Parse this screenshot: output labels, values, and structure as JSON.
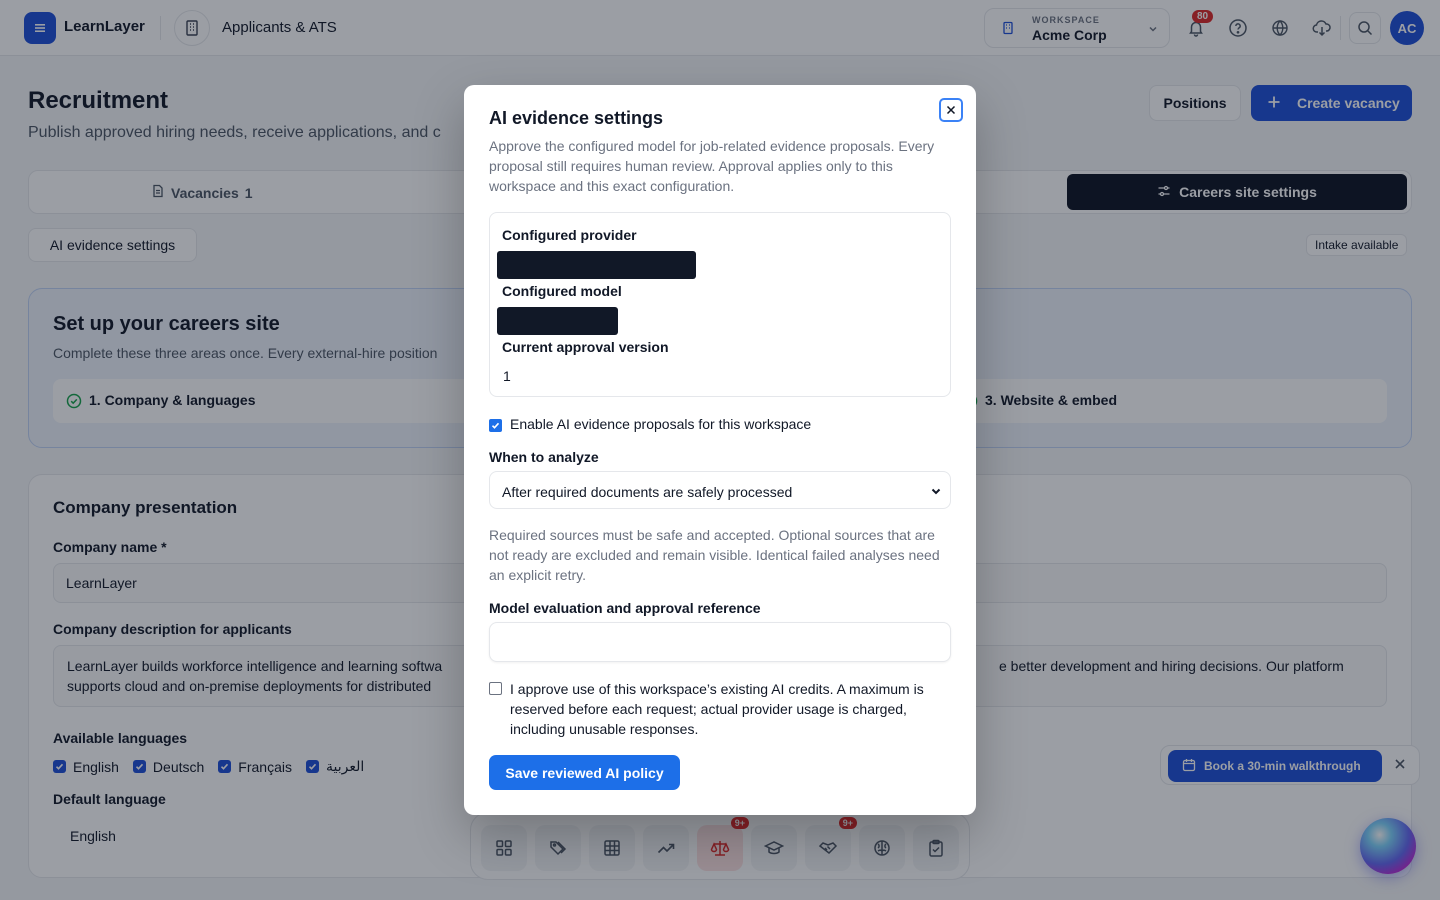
{
  "app": {
    "name": "LearnLayer",
    "module_title": "Applicants & ATS"
  },
  "workspace": {
    "label": "WORKSPACE",
    "name": "Acme Corp"
  },
  "header": {
    "notifications_count": "80",
    "avatar_initials": "AC"
  },
  "page": {
    "title": "Recruitment",
    "subtitle": "Publish approved hiring needs, receive applications, and c",
    "positions_label": "Positions",
    "create_label": "Create vacancy"
  },
  "tabs": {
    "vacancies_label": "Vacancies",
    "vacancies_count": "1",
    "careers_label": "Careers site settings"
  },
  "ai_settings_button": "AI evidence settings",
  "intake_badge": "Intake available",
  "setup": {
    "title": "Set up your careers site",
    "desc": "Complete these three areas once. Every external-hire position",
    "step1": "1. Company & languages",
    "step3": "3. Website & embed"
  },
  "presentation": {
    "title": "Company presentation",
    "company_name_label": "Company name *",
    "company_name_value": "LearnLayer",
    "desc_label": "Company description for applicants",
    "desc_line1_left": "LearnLayer builds workforce intelligence and learning softwa",
    "desc_line1_right": "e better development and hiring decisions. Our platform",
    "desc_line2_left": "supports cloud and on-premise deployments for distributed",
    "languages_label": "Available languages",
    "languages": [
      "English",
      "Deutsch",
      "Français",
      "العربية"
    ],
    "default_lang_label": "Default language",
    "default_lang_value": "English"
  },
  "dock": {
    "badge_a": "9+",
    "badge_b": "9+"
  },
  "walkthrough": {
    "label": "Book a 30-min walkthrough"
  },
  "modal": {
    "title": "AI evidence settings",
    "description": "Approve the configured model for job-related evidence proposals. Every proposal still requires human review. Approval applies only to this workspace and this exact configuration.",
    "provider_label": "Configured provider",
    "provider_value": "redacted-provider",
    "model_label": "Configured model",
    "model_value": "redacted-model",
    "version_label": "Current approval version",
    "version_value": "1",
    "enable_label": "Enable AI evidence proposals for this workspace",
    "enable_checked": true,
    "analyze_label": "When to analyze",
    "analyze_value": "After required documents are safely processed",
    "help_text": "Required sources must be safe and accepted. Optional sources that are not ready are excluded and remain visible. Identical failed analyses need an explicit retry.",
    "reference_label": "Model evaluation and approval reference",
    "reference_value": "",
    "approve_text": "I approve use of this workspace’s existing AI credits. A maximum is reserved before each request; actual provider usage is charged, including unusable responses.",
    "approve_checked": false,
    "save_label": "Save reviewed AI policy"
  },
  "colors": {
    "accent": "#1d6fe8",
    "brand": "#1d4ed8",
    "dark_tab": "#0b1222",
    "badge": "#dc2626"
  }
}
